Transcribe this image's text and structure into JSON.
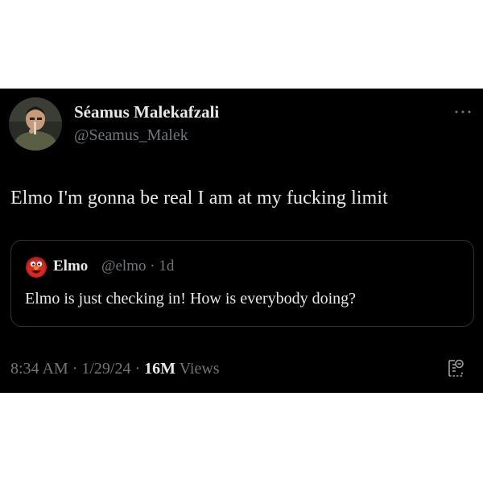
{
  "tweet": {
    "author": {
      "display_name": "Séamus Malekafzali",
      "handle": "@Seamus_Malek"
    },
    "text": "Elmo I'm gonna be real I am at my fucking limit",
    "quoted_tweet": {
      "display_name": "Elmo",
      "handle_and_time": "@elmo · 1d",
      "text": "Elmo is just checking in! How is everybody doing?"
    },
    "meta": {
      "time": "8:34 AM",
      "separator": "·",
      "date": "1/29/24",
      "views_count": "16M",
      "views_label": "Views"
    }
  },
  "colors": {
    "background": "#000000",
    "primary_text": "#e7e9ea",
    "secondary_text": "#71767b",
    "border": "#2f3336"
  },
  "icons": {
    "more": "more-horizontal-icon",
    "analytics": "analytics-icon"
  }
}
